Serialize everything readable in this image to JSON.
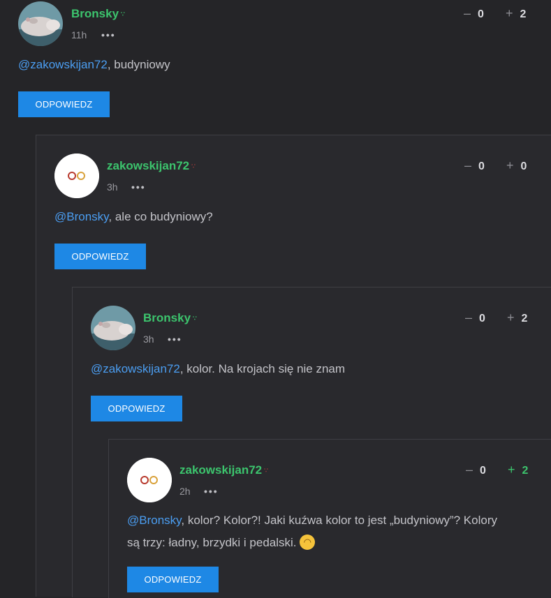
{
  "comments": [
    {
      "author": "Bronsky",
      "time": "11h",
      "more": "•••",
      "downvote_symbol": "–",
      "downvotes": "0",
      "upvote_symbol": "+",
      "upvotes": "2",
      "mention": "@zakowskijan72",
      "text": ", budyniowy",
      "reply_label": "ODPOWIEDZ",
      "avatar_icon": "hippo-avatar-icon"
    },
    {
      "author": "zakowskijan72",
      "time": "3h",
      "more": "•••",
      "downvote_symbol": "–",
      "downvotes": "0",
      "upvote_symbol": "+",
      "upvotes": "0",
      "mention": "@Bronsky",
      "text": ", ale co budyniowy?",
      "reply_label": "ODPOWIEDZ",
      "avatar_icon": "rings-avatar-icon"
    },
    {
      "author": "Bronsky",
      "time": "3h",
      "more": "•••",
      "downvote_symbol": "–",
      "downvotes": "0",
      "upvote_symbol": "+",
      "upvotes": "2",
      "mention": "@zakowskijan72",
      "text": ", kolor. Na krojach się nie znam",
      "reply_label": "ODPOWIEDZ",
      "avatar_icon": "hippo-avatar-icon"
    },
    {
      "author": "zakowskijan72",
      "time": "2h",
      "more": "•••",
      "downvote_symbol": "–",
      "downvotes": "0",
      "upvote_symbol": "+",
      "upvotes": "2",
      "mention": "@Bronsky",
      "text_line1": ", kolor? Kolor?! Jaki kuźwa kolor to jest „budyniowy”? Kolory",
      "text_line2": "są trzy: ładny, brzydki i pedalski.",
      "emoji": "wink",
      "reply_label": "ODPOWIEDZ",
      "avatar_icon": "rings-avatar-icon"
    }
  ],
  "colors": {
    "background": "#252528",
    "author": "#3cc46d",
    "mention": "#4b9ef2",
    "reply_button": "#1e88e5"
  }
}
